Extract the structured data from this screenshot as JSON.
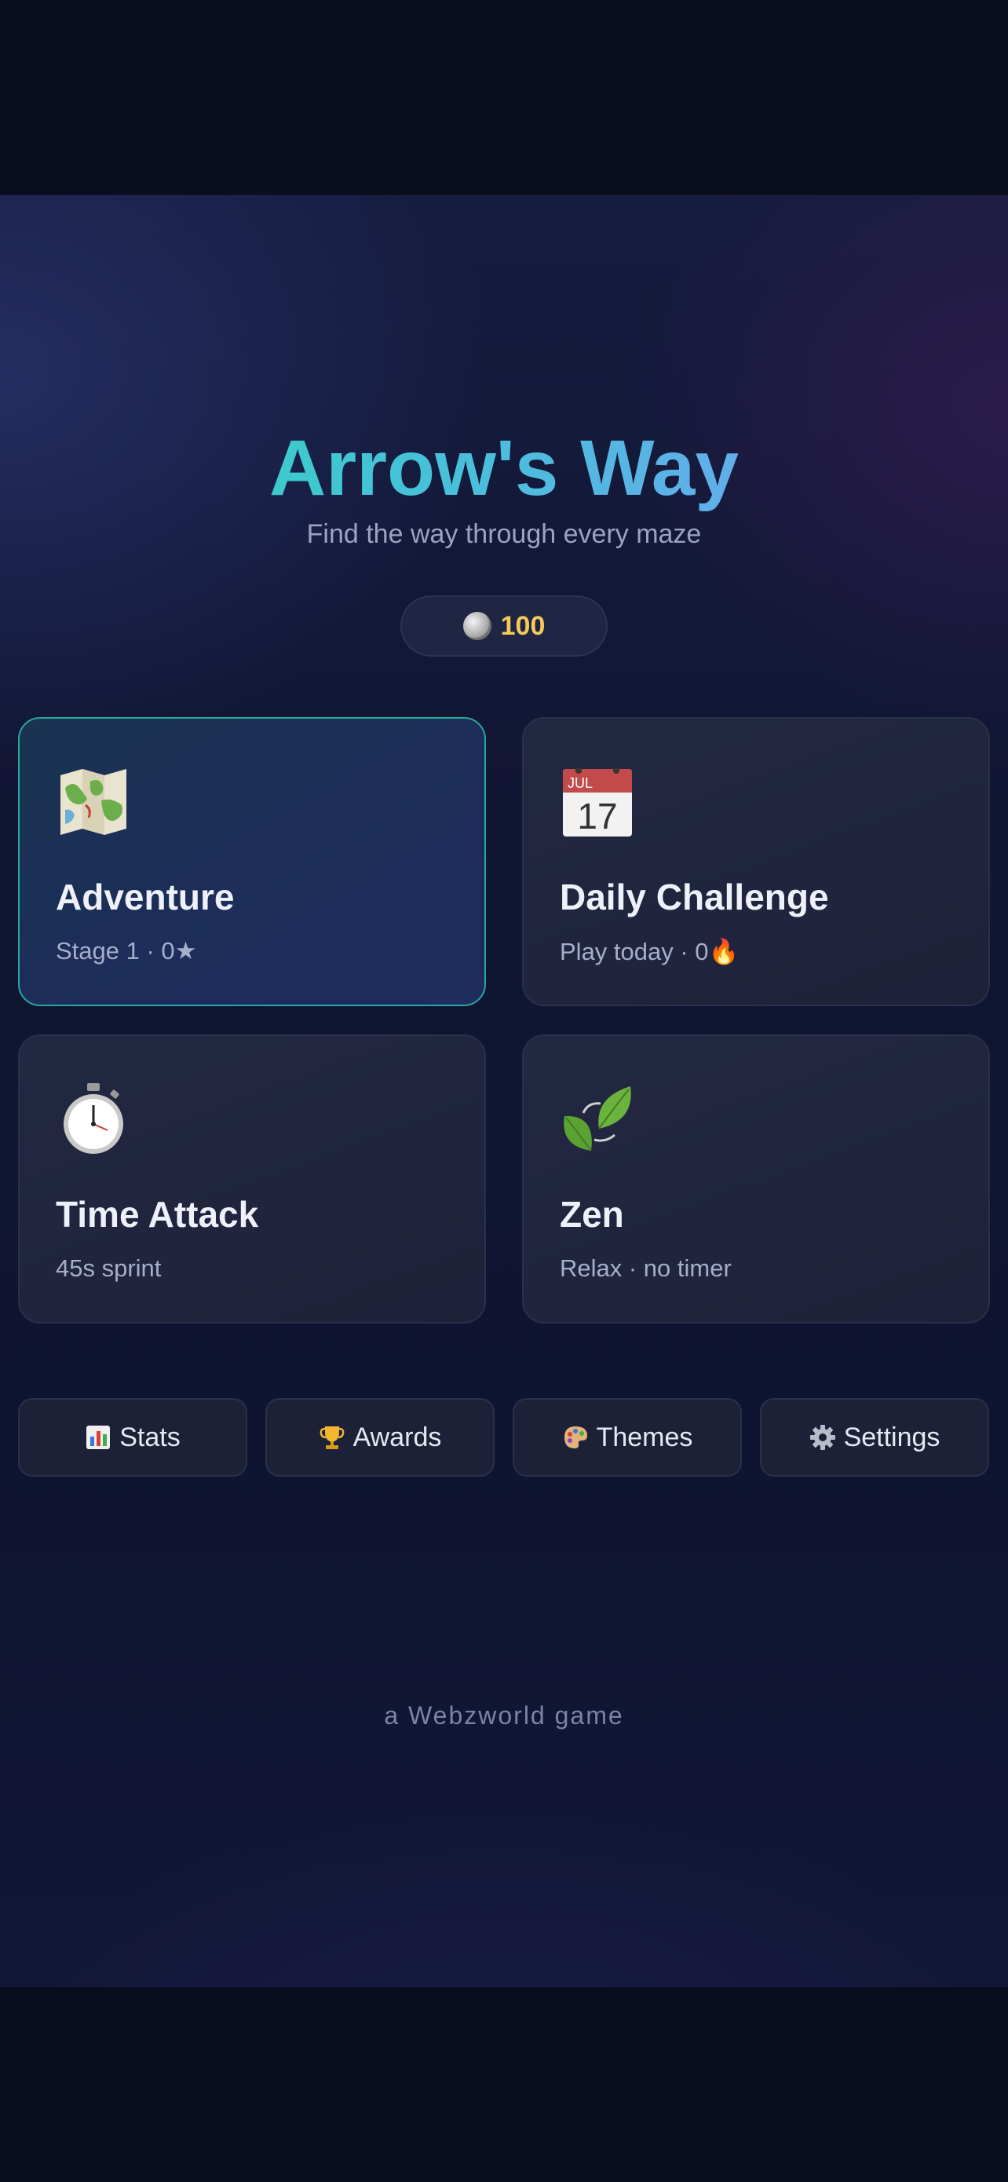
{
  "app": {
    "title": "Arrow's Way",
    "subtitle": "Find the way through every maze",
    "footer": "a Webzworld game"
  },
  "wallet": {
    "coins": "100",
    "icon": "coin-icon",
    "color": "#f5c95c"
  },
  "modes": [
    {
      "name": "Adventure",
      "meta": "Stage 1 · 0★",
      "icon": "map-icon",
      "selected": true
    },
    {
      "name": "Daily Challenge",
      "meta": "Play today · 0🔥",
      "icon": "calendar-icon",
      "selected": false
    },
    {
      "name": "Time Attack",
      "meta": "45s sprint",
      "icon": "stopwatch-icon",
      "selected": false
    },
    {
      "name": "Zen",
      "meta": "Relax · no timer",
      "icon": "leaf-icon",
      "selected": false
    }
  ],
  "menu": [
    {
      "label": "Stats",
      "icon": "bar-chart-icon"
    },
    {
      "label": "Awards",
      "icon": "trophy-icon"
    },
    {
      "label": "Themes",
      "icon": "palette-icon"
    },
    {
      "label": "Settings",
      "icon": "gear-icon"
    }
  ],
  "colors": {
    "accent_teal": "#2ed8b8",
    "accent_blue": "#7a9cf8",
    "selected_border": "#2aa7a0"
  }
}
